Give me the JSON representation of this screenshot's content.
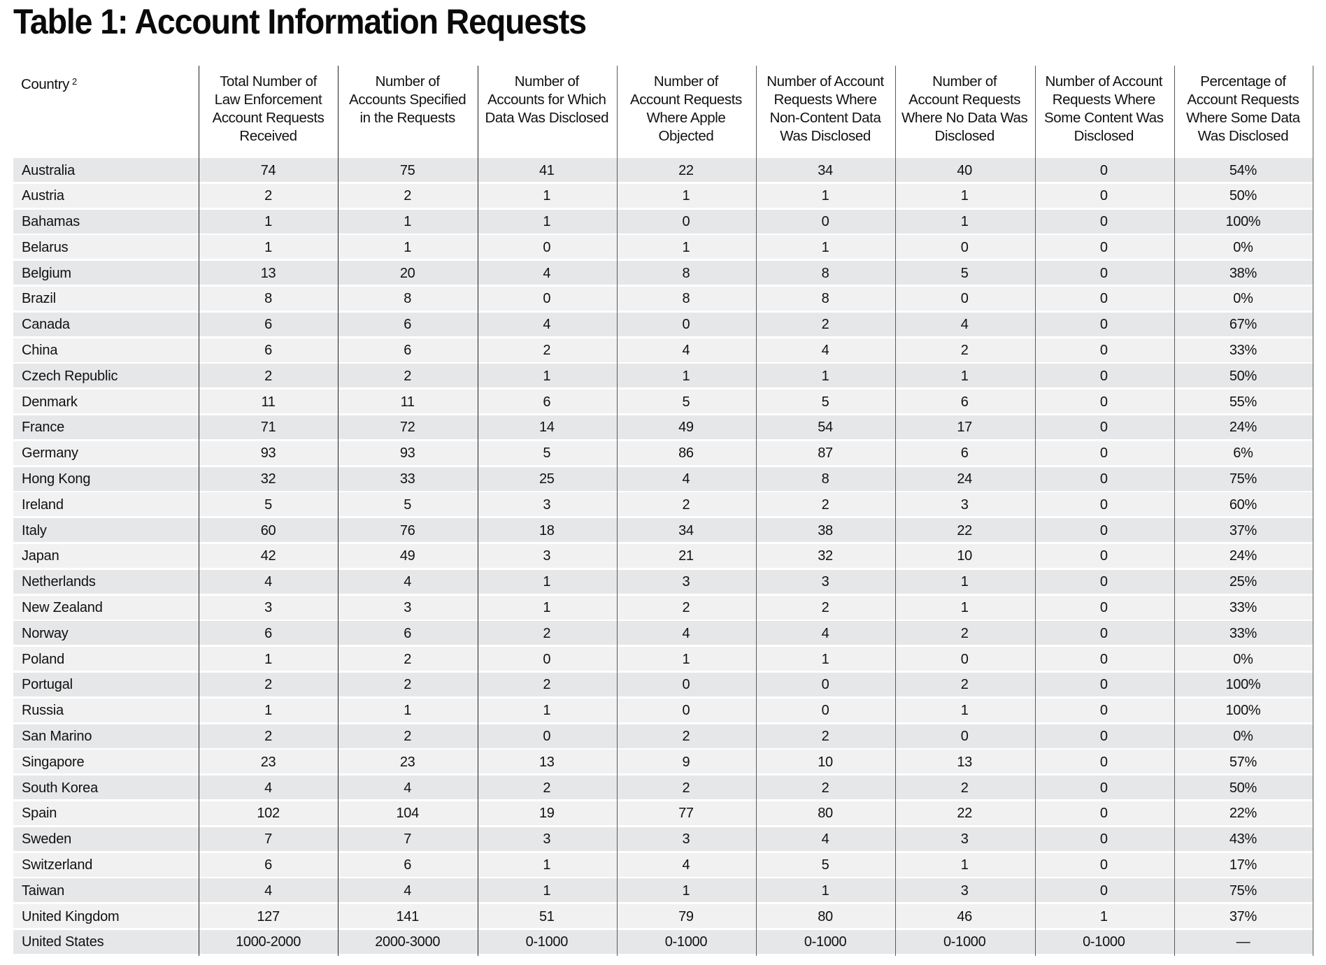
{
  "title": "Table 1: Account Information Requests",
  "table": {
    "headers": [
      {
        "lines": [
          "Country"
        ],
        "superscript": "2"
      },
      {
        "lines": [
          "Total Number of",
          "Law Enforcement",
          "Account Requests",
          "Received"
        ]
      },
      {
        "lines": [
          "Number of",
          "Accounts Specified",
          "in the Requests"
        ]
      },
      {
        "lines": [
          "Number of",
          "Accounts for Which",
          "Data Was Disclosed"
        ]
      },
      {
        "lines": [
          "Number of",
          "Account Requests",
          "Where Apple",
          "Objected"
        ]
      },
      {
        "lines": [
          "Number of Account",
          "Requests Where",
          "Non-Content Data",
          "Was Disclosed"
        ]
      },
      {
        "lines": [
          "Number of",
          "Account Requests",
          "Where No Data Was",
          "Disclosed"
        ]
      },
      {
        "lines": [
          "Number of Account",
          "Requests Where",
          "Some Content Was",
          "Disclosed"
        ]
      },
      {
        "lines": [
          "Percentage of",
          "Account Requests",
          "Where Some Data",
          "Was Disclosed"
        ]
      }
    ],
    "rows": [
      [
        "Australia",
        "74",
        "75",
        "41",
        "22",
        "34",
        "40",
        "0",
        "54%"
      ],
      [
        "Austria",
        "2",
        "2",
        "1",
        "1",
        "1",
        "1",
        "0",
        "50%"
      ],
      [
        "Bahamas",
        "1",
        "1",
        "1",
        "0",
        "0",
        "1",
        "0",
        "100%"
      ],
      [
        "Belarus",
        "1",
        "1",
        "0",
        "1",
        "1",
        "0",
        "0",
        "0%"
      ],
      [
        "Belgium",
        "13",
        "20",
        "4",
        "8",
        "8",
        "5",
        "0",
        "38%"
      ],
      [
        "Brazil",
        "8",
        "8",
        "0",
        "8",
        "8",
        "0",
        "0",
        "0%"
      ],
      [
        "Canada",
        "6",
        "6",
        "4",
        "0",
        "2",
        "4",
        "0",
        "67%"
      ],
      [
        "China",
        "6",
        "6",
        "2",
        "4",
        "4",
        "2",
        "0",
        "33%"
      ],
      [
        "Czech Republic",
        "2",
        "2",
        "1",
        "1",
        "1",
        "1",
        "0",
        "50%"
      ],
      [
        "Denmark",
        "11",
        "11",
        "6",
        "5",
        "5",
        "6",
        "0",
        "55%"
      ],
      [
        "France",
        "71",
        "72",
        "14",
        "49",
        "54",
        "17",
        "0",
        "24%"
      ],
      [
        "Germany",
        "93",
        "93",
        "5",
        "86",
        "87",
        "6",
        "0",
        "6%"
      ],
      [
        "Hong Kong",
        "32",
        "33",
        "25",
        "4",
        "8",
        "24",
        "0",
        "75%"
      ],
      [
        "Ireland",
        "5",
        "5",
        "3",
        "2",
        "2",
        "3",
        "0",
        "60%"
      ],
      [
        "Italy",
        "60",
        "76",
        "18",
        "34",
        "38",
        "22",
        "0",
        "37%"
      ],
      [
        "Japan",
        "42",
        "49",
        "3",
        "21",
        "32",
        "10",
        "0",
        "24%"
      ],
      [
        "Netherlands",
        "4",
        "4",
        "1",
        "3",
        "3",
        "1",
        "0",
        "25%"
      ],
      [
        "New Zealand",
        "3",
        "3",
        "1",
        "2",
        "2",
        "1",
        "0",
        "33%"
      ],
      [
        "Norway",
        "6",
        "6",
        "2",
        "4",
        "4",
        "2",
        "0",
        "33%"
      ],
      [
        "Poland",
        "1",
        "2",
        "0",
        "1",
        "1",
        "0",
        "0",
        "0%"
      ],
      [
        "Portugal",
        "2",
        "2",
        "2",
        "0",
        "0",
        "2",
        "0",
        "100%"
      ],
      [
        "Russia",
        "1",
        "1",
        "1",
        "0",
        "0",
        "1",
        "0",
        "100%"
      ],
      [
        "San Marino",
        "2",
        "2",
        "0",
        "2",
        "2",
        "0",
        "0",
        "0%"
      ],
      [
        "Singapore",
        "23",
        "23",
        "13",
        "9",
        "10",
        "13",
        "0",
        "57%"
      ],
      [
        "South Korea",
        "4",
        "4",
        "2",
        "2",
        "2",
        "2",
        "0",
        "50%"
      ],
      [
        "Spain",
        "102",
        "104",
        "19",
        "77",
        "80",
        "22",
        "0",
        "22%"
      ],
      [
        "Sweden",
        "7",
        "7",
        "3",
        "3",
        "4",
        "3",
        "0",
        "43%"
      ],
      [
        "Switzerland",
        "6",
        "6",
        "1",
        "4",
        "5",
        "1",
        "0",
        "17%"
      ],
      [
        "Taiwan",
        "4",
        "4",
        "1",
        "1",
        "1",
        "3",
        "0",
        "75%"
      ],
      [
        "United Kingdom",
        "127",
        "141",
        "51",
        "79",
        "80",
        "46",
        "1",
        "37%"
      ],
      [
        "United States",
        "1000-2000",
        "2000-3000",
        "0-1000",
        "0-1000",
        "0-1000",
        "0-1000",
        "0-1000",
        "—"
      ]
    ]
  }
}
